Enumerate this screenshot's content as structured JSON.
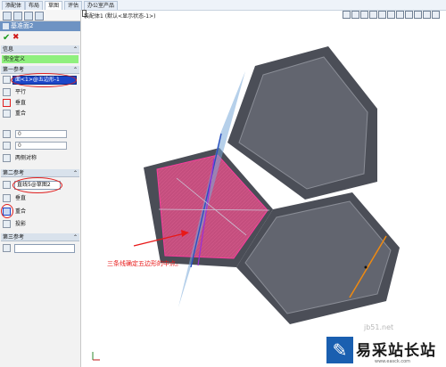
{
  "tabs": [
    {
      "label": "添配体",
      "active": false
    },
    {
      "label": "布局",
      "active": false
    },
    {
      "label": "草图",
      "active": true
    },
    {
      "label": "评估",
      "active": false
    },
    {
      "label": "办公室产品",
      "active": false
    }
  ],
  "panel": {
    "title": "基准面2",
    "ok_icon": "check-icon",
    "cancel_icon": "close-icon",
    "message_header": "信息",
    "message": "完全定义",
    "first_ref": {
      "header": "第一参考",
      "selection": "面<1>@五边形-1",
      "options": [
        "平行",
        "垂直",
        "重合"
      ],
      "angle_value": "0",
      "distance_value": "0",
      "mirror_label": "两侧对称"
    },
    "second_ref": {
      "header": "第二参考",
      "selection": "直线5@草图2",
      "options": [
        "垂直",
        "重合",
        "投影"
      ]
    },
    "third_ref": {
      "header": "第三参考"
    }
  },
  "view": {
    "title": "装配体1 (默认<显示状态-1>)"
  },
  "annotation": "三条线确定五边形的中点。",
  "brand": {
    "name": "易采站长站",
    "url": "www.easck.com",
    "watermark": "jb51.net"
  },
  "colors": {
    "accent": "#1c46c8",
    "annotation": "#e81818",
    "status_green": "#8ff07e"
  }
}
